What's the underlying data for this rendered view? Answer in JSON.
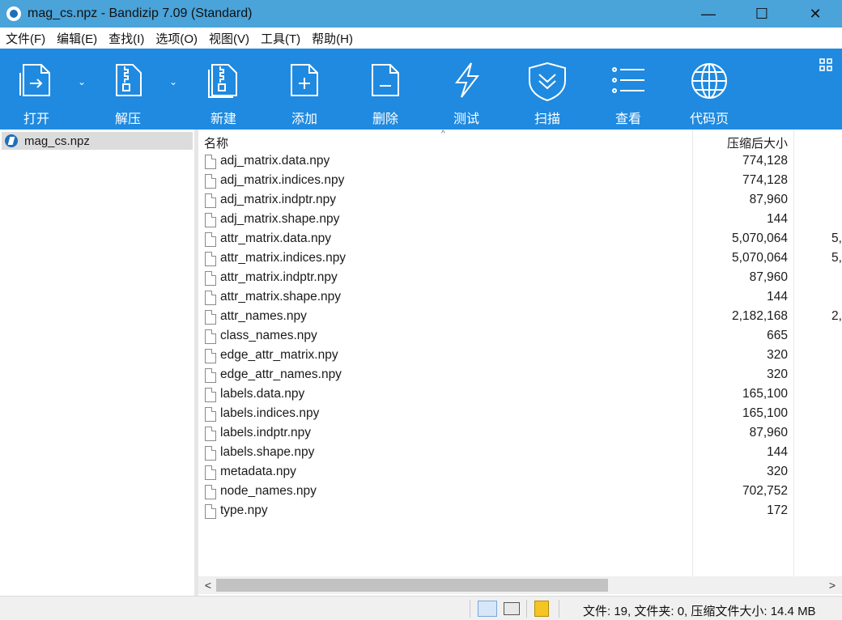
{
  "window": {
    "title": "mag_cs.npz - Bandizip 7.09 (Standard)",
    "minimize": "—",
    "maximize": "☐",
    "close": "✕"
  },
  "menu": [
    "文件(F)",
    "编辑(E)",
    "查找(I)",
    "选项(O)",
    "视图(V)",
    "工具(T)",
    "帮助(H)"
  ],
  "toolbar": {
    "open": "打开",
    "extract": "解压",
    "new": "新建",
    "add": "添加",
    "delete": "删除",
    "test": "测试",
    "scan": "扫描",
    "view": "查看",
    "codepage": "代码页"
  },
  "tree": {
    "root": "mag_cs.npz"
  },
  "columns": {
    "name": "名称",
    "packed_size": "压缩后大小"
  },
  "files": [
    {
      "name": "adj_matrix.data.npy",
      "size": "774,128",
      "orig": ""
    },
    {
      "name": "adj_matrix.indices.npy",
      "size": "774,128",
      "orig": ""
    },
    {
      "name": "adj_matrix.indptr.npy",
      "size": "87,960",
      "orig": ""
    },
    {
      "name": "adj_matrix.shape.npy",
      "size": "144",
      "orig": ""
    },
    {
      "name": "attr_matrix.data.npy",
      "size": "5,070,064",
      "orig": "5,"
    },
    {
      "name": "attr_matrix.indices.npy",
      "size": "5,070,064",
      "orig": "5,"
    },
    {
      "name": "attr_matrix.indptr.npy",
      "size": "87,960",
      "orig": ""
    },
    {
      "name": "attr_matrix.shape.npy",
      "size": "144",
      "orig": ""
    },
    {
      "name": "attr_names.npy",
      "size": "2,182,168",
      "orig": "2,"
    },
    {
      "name": "class_names.npy",
      "size": "665",
      "orig": ""
    },
    {
      "name": "edge_attr_matrix.npy",
      "size": "320",
      "orig": ""
    },
    {
      "name": "edge_attr_names.npy",
      "size": "320",
      "orig": ""
    },
    {
      "name": "labels.data.npy",
      "size": "165,100",
      "orig": ""
    },
    {
      "name": "labels.indices.npy",
      "size": "165,100",
      "orig": ""
    },
    {
      "name": "labels.indptr.npy",
      "size": "87,960",
      "orig": ""
    },
    {
      "name": "labels.shape.npy",
      "size": "144",
      "orig": ""
    },
    {
      "name": "metadata.npy",
      "size": "320",
      "orig": ""
    },
    {
      "name": "node_names.npy",
      "size": "702,752",
      "orig": ""
    },
    {
      "name": "type.npy",
      "size": "172",
      "orig": ""
    }
  ],
  "scroll": {
    "left": "<",
    "right": ">"
  },
  "status": {
    "text": "文件: 19, 文件夹: 0, 压缩文件大小: 14.4 MB"
  },
  "colors": {
    "titlebar": "#4aa3d9",
    "toolbar": "#1f8ae0"
  }
}
